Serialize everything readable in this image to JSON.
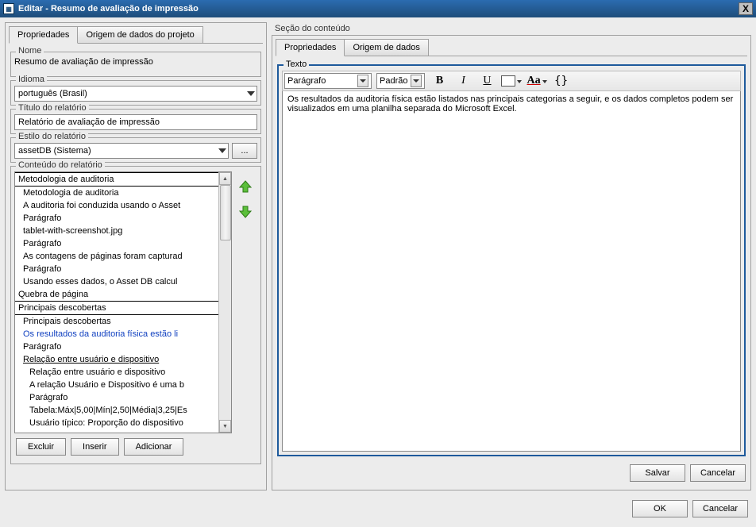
{
  "title": "Editar - Resumo de avaliação de impressão",
  "left": {
    "tabs": {
      "properties": "Propriedades",
      "data_origin": "Origem de dados do projeto"
    },
    "name_label": "Nome",
    "name_value": "Resumo de avaliação de impressão",
    "language_label": "Idioma",
    "language_value": "português (Brasil)",
    "report_title_label": "Título do relatório",
    "report_title_value": "Relatório de avaliação de impressão",
    "style_label": "Estilo do relatório",
    "style_value": "assetDB (Sistema)",
    "ellipsis": "...",
    "content_label": "Conteúdo do relatório",
    "content_items": [
      {
        "text": "Metodologia de auditoria",
        "heading": true
      },
      {
        "text": "Metodologia de auditoria",
        "lvl": 1
      },
      {
        "text": "A auditoria foi conduzida usando o Asset",
        "lvl": 1
      },
      {
        "text": "Parágrafo",
        "lvl": 1
      },
      {
        "text": "tablet-with-screenshot.jpg",
        "lvl": 1
      },
      {
        "text": "Parágrafo",
        "lvl": 1
      },
      {
        "text": "As contagens de páginas foram capturad",
        "lvl": 1
      },
      {
        "text": "Parágrafo",
        "lvl": 1
      },
      {
        "text": "Usando esses dados, o Asset DB calcul",
        "lvl": 1
      },
      {
        "text": "Quebra de página"
      },
      {
        "text": "Principais descobertas",
        "heading": true
      },
      {
        "text": "Principais descobertas",
        "lvl": 1
      },
      {
        "text": "Os resultados da auditoria física estão li",
        "lvl": 1,
        "selected": true
      },
      {
        "text": "Parágrafo",
        "lvl": 1
      },
      {
        "text": "Relação entre usuário e dispositivo",
        "lvl": 1,
        "sub": true
      },
      {
        "text": "Relação entre usuário e dispositivo",
        "lvl": 2
      },
      {
        "text": "A relação Usuário e Dispositivo é uma b",
        "lvl": 2
      },
      {
        "text": "Parágrafo",
        "lvl": 2
      },
      {
        "text": "Tabela:Máx|5,00|Mín|2,50|Média|3,25|Es",
        "lvl": 2
      },
      {
        "text": "Usuário típico: Proporção do dispositivo",
        "lvl": 2
      }
    ],
    "buttons": {
      "delete": "Excluir",
      "insert": "Inserir",
      "add": "Adicionar"
    }
  },
  "right": {
    "section_label": "Seção do conteúdo",
    "tabs": {
      "properties": "Propriedades",
      "data_origin": "Origem de dados"
    },
    "texto_label": "Texto",
    "para_style": "Parágrafo",
    "char_style": "Padrão",
    "tb": {
      "bold": "B",
      "italic": "I",
      "underline": "U",
      "textcolor": "Aa",
      "braces": "{}"
    },
    "editor_text": "Os resultados da auditoria física estão listados nas principais categorias a seguir, e os dados completos podem ser visualizados em uma planilha separada do Microsoft Excel.",
    "buttons": {
      "save": "Salvar",
      "cancel": "Cancelar"
    }
  },
  "bottom": {
    "ok": "OK",
    "cancel": "Cancelar"
  }
}
